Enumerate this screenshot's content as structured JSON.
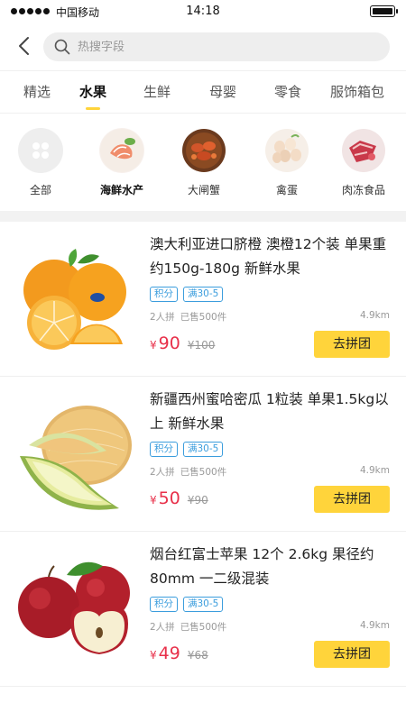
{
  "status_bar": {
    "carrier": "中国移动",
    "time": "14:18"
  },
  "search": {
    "placeholder": "热搜字段"
  },
  "tabs": [
    {
      "label": "精选",
      "active": false
    },
    {
      "label": "水果",
      "active": true
    },
    {
      "label": "生鲜",
      "active": false
    },
    {
      "label": "母婴",
      "active": false
    },
    {
      "label": "零食",
      "active": false
    },
    {
      "label": "服饰箱包",
      "active": false
    }
  ],
  "categories": [
    {
      "label": "全部",
      "icon": "all-grid-icon",
      "active": false
    },
    {
      "label": "海鲜水产",
      "icon": "seafood-image",
      "active": true
    },
    {
      "label": "大闸蟹",
      "icon": "crab-image",
      "active": false
    },
    {
      "label": "禽蛋",
      "icon": "eggs-image",
      "active": false
    },
    {
      "label": "肉冻食品",
      "icon": "frozen-meat-image",
      "active": false
    }
  ],
  "products": [
    {
      "title": "澳大利亚进口脐橙 澳橙12个装 单果重约150g-180g 新鲜水果",
      "tags": [
        "积分",
        "满30-5"
      ],
      "group_size": "2人拼",
      "sold": "已售500件",
      "distance": "4.9km",
      "currency": "¥",
      "price": "90",
      "original_price": "¥100",
      "button": "去拼团",
      "image": "orange-image"
    },
    {
      "title": "新疆西州蜜哈密瓜 1粒装 单果1.5kg以上 新鲜水果",
      "tags": [
        "积分",
        "满30-5"
      ],
      "group_size": "2人拼",
      "sold": "已售500件",
      "distance": "4.9km",
      "currency": "¥",
      "price": "50",
      "original_price": "¥90",
      "button": "去拼团",
      "image": "melon-image"
    },
    {
      "title": "烟台红富士苹果 12个 2.6kg 果径约80mm 一二级混装",
      "tags": [
        "积分",
        "满30-5"
      ],
      "group_size": "2人拼",
      "sold": "已售500件",
      "distance": "4.9km",
      "currency": "¥",
      "price": "49",
      "original_price": "¥68",
      "button": "去拼团",
      "image": "apple-image"
    }
  ],
  "colors": {
    "accent_yellow": "#ffd43b",
    "price_red": "#e8304a",
    "tag_blue": "#3b9ddd"
  }
}
